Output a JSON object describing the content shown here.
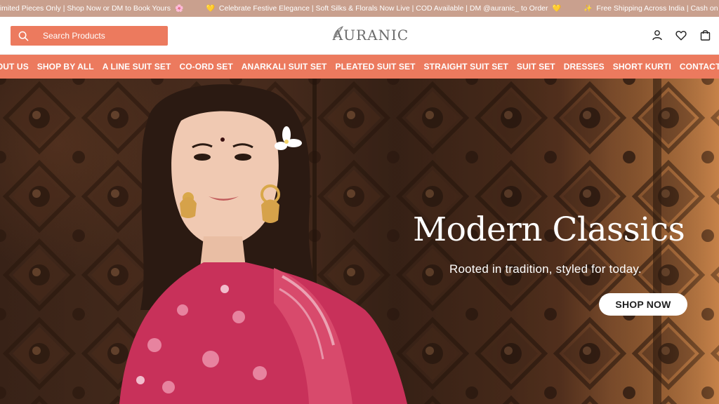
{
  "announcement": {
    "items": [
      {
        "text": "Limited Pieces Only | Shop Now or DM to Book Yours",
        "emoji": "🌸"
      },
      {
        "text": "Celebrate Festive Elegance | Soft Silks & Florals Now Live | COD Available | DM @auranic_ to Order",
        "emoji_before": "💛",
        "emoji": "💛"
      },
      {
        "text": "Free Shipping Across India | Cash on Delivery Available",
        "emoji_before": "✨"
      }
    ]
  },
  "header": {
    "search_placeholder": "Search Products",
    "logo_text": "AURANIC",
    "icons": [
      "account-icon",
      "heart-icon",
      "bag-icon"
    ]
  },
  "nav": {
    "items": [
      "ABOUT US",
      "SHOP BY ALL",
      "A LINE SUIT SET",
      "CO-ORD SET",
      "ANARKALI SUIT SET",
      "PLEATED SUIT SET",
      "STRAIGHT SUIT SET",
      "SUIT SET",
      "DRESSES",
      "SHORT KURTI",
      "CONTACT US"
    ]
  },
  "hero": {
    "title": "Modern Classics",
    "subtitle": "Rooted in tradition, styled for today.",
    "cta_label": "SHOP NOW"
  },
  "colors": {
    "announcement_bg": "#c9a08e",
    "accent": "#ec7a5e",
    "text_light": "#ffffff"
  }
}
